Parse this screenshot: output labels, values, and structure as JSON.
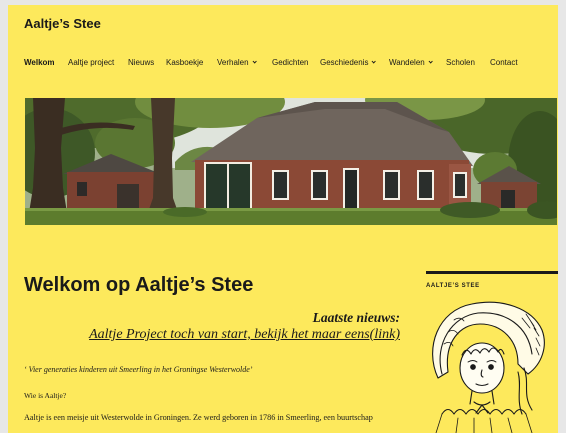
{
  "site": {
    "title": "Aaltje’s Stee"
  },
  "nav": {
    "items": [
      {
        "label": "Welkom",
        "active": true
      },
      {
        "label": "Aaltje project"
      },
      {
        "label": "Nieuws"
      },
      {
        "label": "Kasboekje"
      },
      {
        "label": "Verhalen",
        "has_submenu": true
      },
      {
        "label": "Gedichten"
      },
      {
        "label": "Geschiedenis",
        "has_submenu": true
      },
      {
        "label": "Wandelen",
        "has_submenu": true
      },
      {
        "label": "Scholen"
      },
      {
        "label": "Contact"
      }
    ]
  },
  "main": {
    "title": "Welkom op Aaltje’s Stee",
    "news": {
      "heading": "Laatste nieuws:",
      "link": "Aaltje Project toch van start, bekijk het maar eens(link)"
    },
    "tagline": "‘ Vier generaties kinderen uit Smeerling in het Groningse Westerwolde’",
    "question": "Wie is Aaltje?",
    "intro": "Aaltje is een meisje uit Westerwolde in Groningen. Ze werd geboren in 1786 in Smeerling, een buurtschap"
  },
  "sidebar": {
    "widget_title": "AALTJE’S STEE"
  },
  "icons": {
    "submenu": "chevron-down-icon"
  },
  "colors": {
    "page_background": "#fde95c",
    "outer_background": "#e7e7e7",
    "text": "#1a1a1a"
  }
}
